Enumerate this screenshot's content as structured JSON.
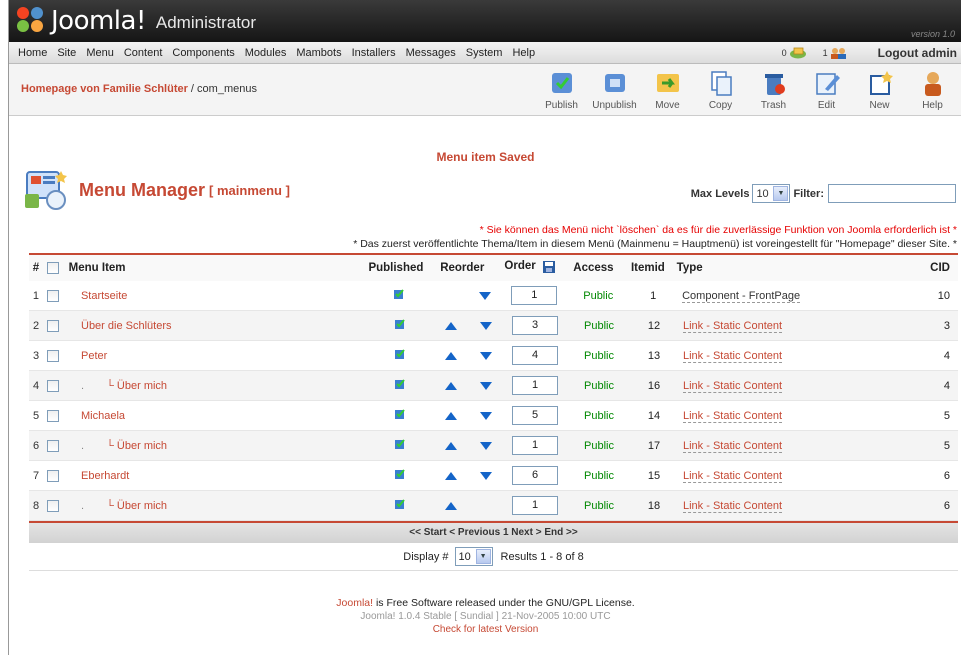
{
  "header": {
    "brand": "Joomla!",
    "brand_suffix": "Administrator",
    "version": "version 1.0"
  },
  "menubar": {
    "items": [
      "Home",
      "Site",
      "Menu",
      "Content",
      "Components",
      "Modules",
      "Mambots",
      "Installers",
      "Messages",
      "System",
      "Help"
    ],
    "messages_count": "0",
    "users_count": "1",
    "logout": "Logout admin"
  },
  "pathway": {
    "site": "Homepage von Familie Schlüter",
    "separator": " / ",
    "component": "com_menus"
  },
  "toolbar": [
    {
      "label": "Publish",
      "icon": "publish-icon"
    },
    {
      "label": "Unpublish",
      "icon": "unpublish-icon"
    },
    {
      "label": "Move",
      "icon": "move-icon"
    },
    {
      "label": "Copy",
      "icon": "copy-icon"
    },
    {
      "label": "Trash",
      "icon": "trash-icon"
    },
    {
      "label": "Edit",
      "icon": "edit-icon"
    },
    {
      "label": "New",
      "icon": "new-icon"
    },
    {
      "label": "Help",
      "icon": "help-icon"
    }
  ],
  "message": "Menu item Saved",
  "heading": {
    "title": "Menu Manager",
    "subtitle": "[ mainmenu ]"
  },
  "filters": {
    "max_levels_label": "Max Levels",
    "max_levels_value": "10",
    "filter_label": "Filter:",
    "filter_value": ""
  },
  "notes": {
    "warning": "* Sie können das Menü nicht `löschen` da es für die zuverlässige Funktion von Joomla erforderlich ist *",
    "info": "* Das zuerst veröffentlichte Thema/Item in diesem Menü (Mainmenu = Hauptmenü) ist voreingestellt für \"Homepage\" dieser Site. *"
  },
  "table": {
    "headers": {
      "num": "#",
      "item": "Menu Item",
      "published": "Published",
      "reorder": "Reorder",
      "order": "Order",
      "access": "Access",
      "itemid": "Itemid",
      "type": "Type",
      "cid": "CID"
    },
    "rows": [
      {
        "num": "1",
        "prefix": "",
        "name": "Startseite",
        "up": false,
        "down": true,
        "order": "1",
        "access": "Public",
        "itemid": "1",
        "type": "Component - FrontPage",
        "type_link": false,
        "cid": "10"
      },
      {
        "num": "2",
        "prefix": "",
        "name": "Über die Schlüters",
        "up": true,
        "down": true,
        "order": "3",
        "access": "Public",
        "itemid": "12",
        "type": "Link - Static Content",
        "type_link": true,
        "cid": "3"
      },
      {
        "num": "3",
        "prefix": "",
        "name": "Peter",
        "up": true,
        "down": true,
        "order": "4",
        "access": "Public",
        "itemid": "13",
        "type": "Link - Static Content",
        "type_link": true,
        "cid": "4"
      },
      {
        "num": "4",
        "prefix": ".",
        "name": "Über mich",
        "up": true,
        "down": true,
        "order": "1",
        "access": "Public",
        "itemid": "16",
        "type": "Link - Static Content",
        "type_link": true,
        "cid": "4"
      },
      {
        "num": "5",
        "prefix": "",
        "name": "Michaela",
        "up": true,
        "down": true,
        "order": "5",
        "access": "Public",
        "itemid": "14",
        "type": "Link - Static Content",
        "type_link": true,
        "cid": "5"
      },
      {
        "num": "6",
        "prefix": ".",
        "name": "Über mich",
        "up": true,
        "down": true,
        "order": "1",
        "access": "Public",
        "itemid": "17",
        "type": "Link - Static Content",
        "type_link": true,
        "cid": "5"
      },
      {
        "num": "7",
        "prefix": "",
        "name": "Eberhardt",
        "up": true,
        "down": true,
        "order": "6",
        "access": "Public",
        "itemid": "15",
        "type": "Link - Static Content",
        "type_link": true,
        "cid": "6"
      },
      {
        "num": "8",
        "prefix": ".",
        "name": "Über mich",
        "up": true,
        "down": false,
        "order": "1",
        "access": "Public",
        "itemid": "18",
        "type": "Link - Static Content",
        "type_link": true,
        "cid": "6"
      }
    ]
  },
  "pagination": {
    "nav": "<< Start < Previous 1 Next > End >>",
    "display_label": "Display #",
    "limit": "10",
    "results": "Results 1 - 8 of 8"
  },
  "footer": {
    "joomla_link": "Joomla!",
    "license_text": " is Free Software released under the GNU/GPL License.",
    "version_line": "Joomla! 1.0.4 Stable [ Sundial ] 21-Nov-2005 10:00 UTC",
    "check_link": "Check for latest Version"
  },
  "colors": {
    "accent": "#c64934",
    "access_public": "#008800",
    "warning": "#e60000",
    "arrow": "#1464c8"
  }
}
